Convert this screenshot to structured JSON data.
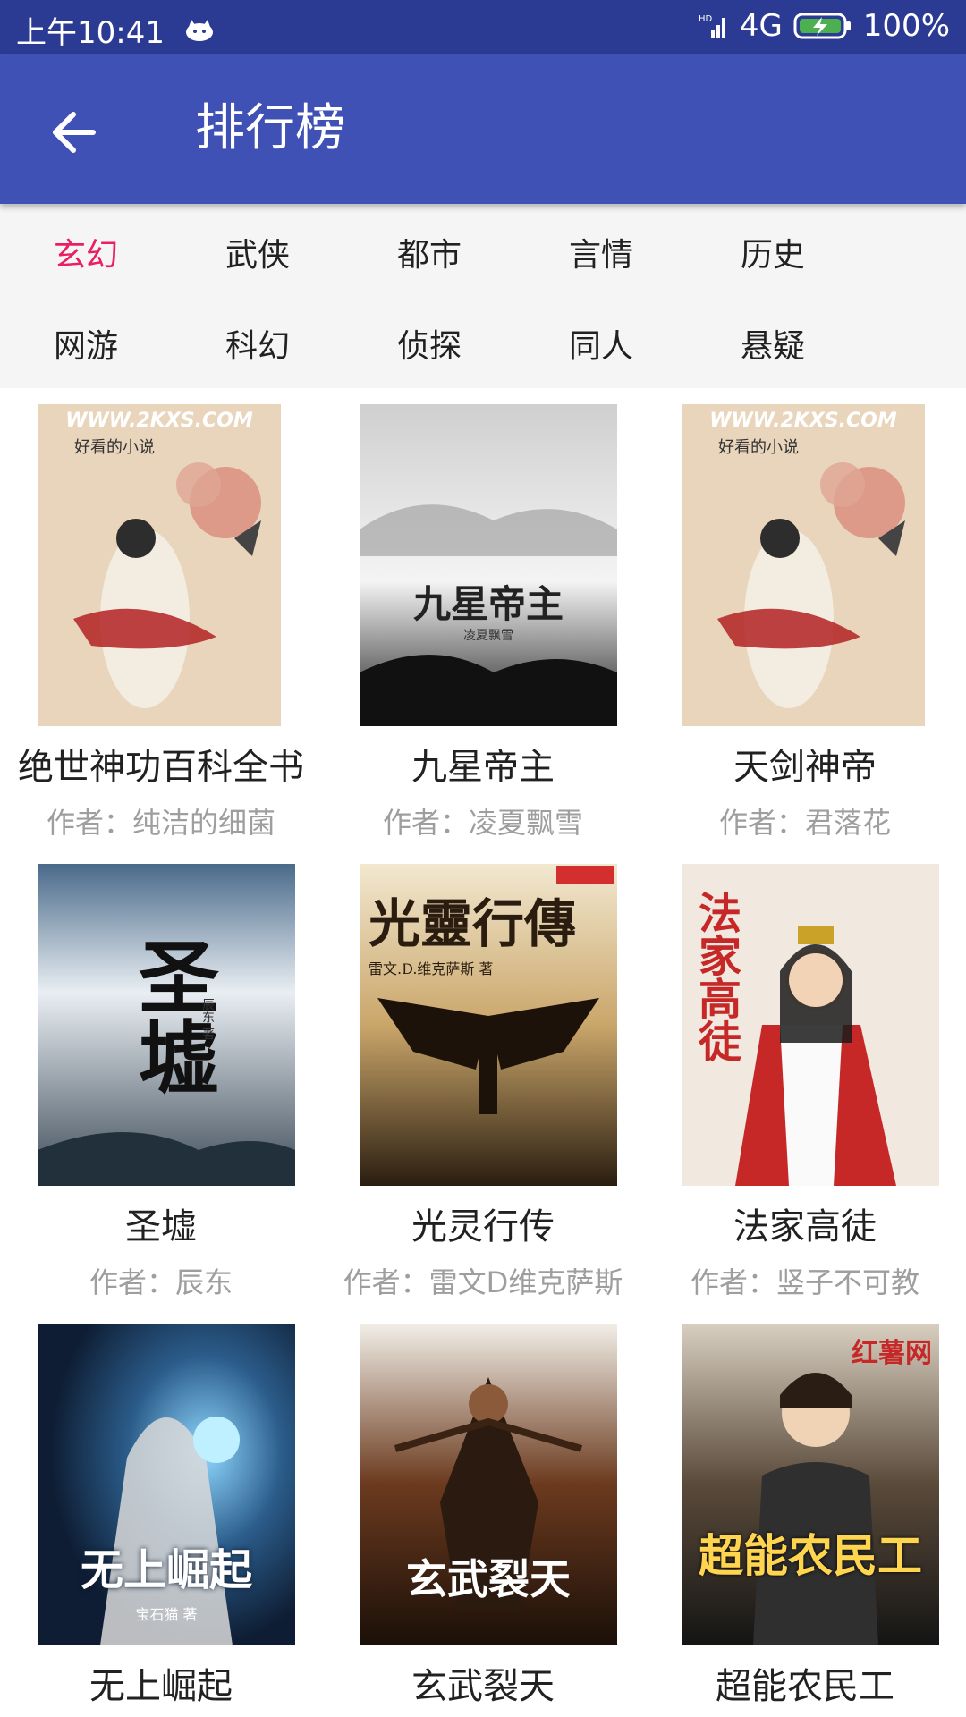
{
  "status_bar": {
    "time": "上午10:41",
    "network": "4G",
    "hd": "HD",
    "battery": "100%"
  },
  "app_bar": {
    "title": "排行榜"
  },
  "categories": {
    "row1": [
      "玄幻",
      "武侠",
      "都市",
      "言情",
      "历史"
    ],
    "row2": [
      "网游",
      "科幻",
      "侦探",
      "同人",
      "悬疑"
    ],
    "active": "玄幻"
  },
  "books": [
    {
      "title": "绝世神功百科全书",
      "author": "作者：纯洁的细菌",
      "cover_text": "WWW.2KXS.COM",
      "cover_sub": "好看的小说"
    },
    {
      "title": "九星帝主",
      "author": "作者：凌夏飘雪",
      "cover_text": "九星帝主",
      "cover_sub": "凌夏飘雪"
    },
    {
      "title": "天剑神帝",
      "author": "作者：君落花",
      "cover_text": "WWW.2KXS.COM",
      "cover_sub": "好看的小说"
    },
    {
      "title": "圣墟",
      "author": "作者：辰东",
      "cover_text": "圣墟",
      "cover_sub": "辰东 著"
    },
    {
      "title": "光灵行传",
      "author": "作者：雷文D维克萨斯",
      "cover_text": "光靈行傳",
      "cover_sub": "雷文.D.维克萨斯 著"
    },
    {
      "title": "法家高徒",
      "author": "作者：竖子不可教",
      "cover_text": "法家高徒",
      "cover_sub": ""
    },
    {
      "title": "无上崛起",
      "author": "",
      "cover_text": "无上崛起",
      "cover_sub": "宝石猫 著"
    },
    {
      "title": "玄武裂天",
      "author": "",
      "cover_text": "玄武裂天",
      "cover_sub": ""
    },
    {
      "title": "超能农民工",
      "author": "",
      "cover_text": "超能农民工",
      "cover_sub": "红薯网"
    }
  ],
  "colors": {
    "status_bar": "#2b3a93",
    "app_bar": "#3f51b5",
    "active_category": "#e91e63",
    "author_text": "#9e9e9e",
    "category_bg": "#f5f5f5"
  }
}
